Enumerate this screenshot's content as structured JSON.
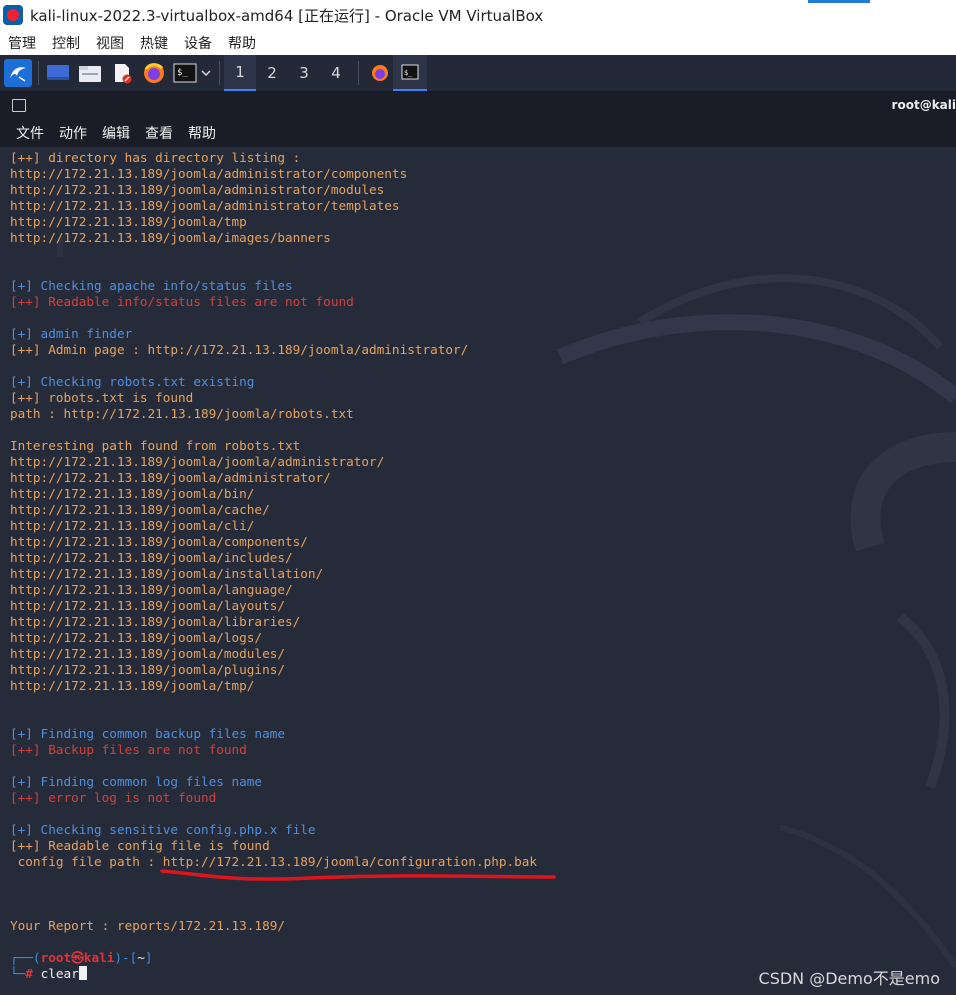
{
  "window": {
    "title": "kali-linux-2022.3-virtualbox-amd64 [正在运行] - Oracle VM VirtualBox",
    "menu": [
      "管理",
      "控制",
      "视图",
      "热键",
      "设备",
      "帮助"
    ]
  },
  "panel": {
    "workspaces": [
      "1",
      "2",
      "3",
      "4"
    ],
    "active_workspace": "1",
    "launcher_icons": [
      "kali-menu-icon",
      "desktop-icon",
      "file-manager-icon",
      "text-editor-icon",
      "firefox-icon",
      "terminal-icon"
    ]
  },
  "terminal": {
    "title": "root@kali",
    "menu": [
      "文件",
      "动作",
      "编辑",
      "查看",
      "帮助"
    ],
    "lines": [
      {
        "t": "[++] directory has directory listing :",
        "c": "orange"
      },
      {
        "t": "http://172.21.13.189/joomla/administrator/components",
        "c": "orange"
      },
      {
        "t": "http://172.21.13.189/joomla/administrator/modules",
        "c": "orange"
      },
      {
        "t": "http://172.21.13.189/joomla/administrator/templates",
        "c": "orange"
      },
      {
        "t": "http://172.21.13.189/joomla/tmp",
        "c": "orange"
      },
      {
        "t": "http://172.21.13.189/joomla/images/banners",
        "c": "orange"
      },
      {
        "t": "",
        "c": "orange"
      },
      {
        "t": "",
        "c": "orange"
      },
      {
        "t": "[+] Checking apache info/status files",
        "c": "blue"
      },
      {
        "t": "[++] Readable info/status files are not found",
        "c": "red"
      },
      {
        "t": "",
        "c": "orange"
      },
      {
        "t": "[+] admin finder",
        "c": "blue"
      },
      {
        "t": "[++] Admin page : http://172.21.13.189/joomla/administrator/",
        "c": "orange"
      },
      {
        "t": "",
        "c": "orange"
      },
      {
        "t": "[+] Checking robots.txt existing",
        "c": "blue"
      },
      {
        "t": "[++] robots.txt is found",
        "c": "orange"
      },
      {
        "t": "path : http://172.21.13.189/joomla/robots.txt",
        "c": "orange"
      },
      {
        "t": "",
        "c": "orange"
      },
      {
        "t": "Interesting path found from robots.txt",
        "c": "orange"
      },
      {
        "t": "http://172.21.13.189/joomla/joomla/administrator/",
        "c": "orange"
      },
      {
        "t": "http://172.21.13.189/joomla/administrator/",
        "c": "orange"
      },
      {
        "t": "http://172.21.13.189/joomla/bin/",
        "c": "orange"
      },
      {
        "t": "http://172.21.13.189/joomla/cache/",
        "c": "orange"
      },
      {
        "t": "http://172.21.13.189/joomla/cli/",
        "c": "orange"
      },
      {
        "t": "http://172.21.13.189/joomla/components/",
        "c": "orange"
      },
      {
        "t": "http://172.21.13.189/joomla/includes/",
        "c": "orange"
      },
      {
        "t": "http://172.21.13.189/joomla/installation/",
        "c": "orange"
      },
      {
        "t": "http://172.21.13.189/joomla/language/",
        "c": "orange"
      },
      {
        "t": "http://172.21.13.189/joomla/layouts/",
        "c": "orange"
      },
      {
        "t": "http://172.21.13.189/joomla/libraries/",
        "c": "orange"
      },
      {
        "t": "http://172.21.13.189/joomla/logs/",
        "c": "orange"
      },
      {
        "t": "http://172.21.13.189/joomla/modules/",
        "c": "orange"
      },
      {
        "t": "http://172.21.13.189/joomla/plugins/",
        "c": "orange"
      },
      {
        "t": "http://172.21.13.189/joomla/tmp/",
        "c": "orange"
      },
      {
        "t": "",
        "c": "orange"
      },
      {
        "t": "",
        "c": "orange"
      },
      {
        "t": "[+] Finding common backup files name",
        "c": "blue"
      },
      {
        "t": "[++] Backup files are not found",
        "c": "red"
      },
      {
        "t": "",
        "c": "orange"
      },
      {
        "t": "[+] Finding common log files name",
        "c": "blue"
      },
      {
        "t": "[++] error log is not found",
        "c": "red"
      },
      {
        "t": "",
        "c": "orange"
      },
      {
        "t": "[+] Checking sensitive config.php.x file",
        "c": "blue"
      },
      {
        "t": "[++] Readable config file is found",
        "c": "orange"
      },
      {
        "t": " config file path : http://172.21.13.189/joomla/configuration.php.bak",
        "c": "orange"
      },
      {
        "t": "",
        "c": "orange"
      },
      {
        "t": "",
        "c": "orange"
      },
      {
        "t": "",
        "c": "orange"
      },
      {
        "t": "Your Report : reports/172.21.13.189/",
        "c": "orange"
      },
      {
        "t": "",
        "c": "orange"
      }
    ],
    "prompt": {
      "open": "┌──(",
      "user": "root㉿kali",
      "close": ")-[",
      "dir": "~",
      "end": "]",
      "corner": "└─",
      "hash": "#",
      "command": "clear"
    }
  },
  "watermark": "CSDN @Demo不是emo",
  "colors": {
    "orange": "#e8a25c",
    "blue": "#4f8fe0",
    "red": "#d4403a",
    "terminal_bg": "#262b39",
    "annotation": "#e0141c"
  }
}
